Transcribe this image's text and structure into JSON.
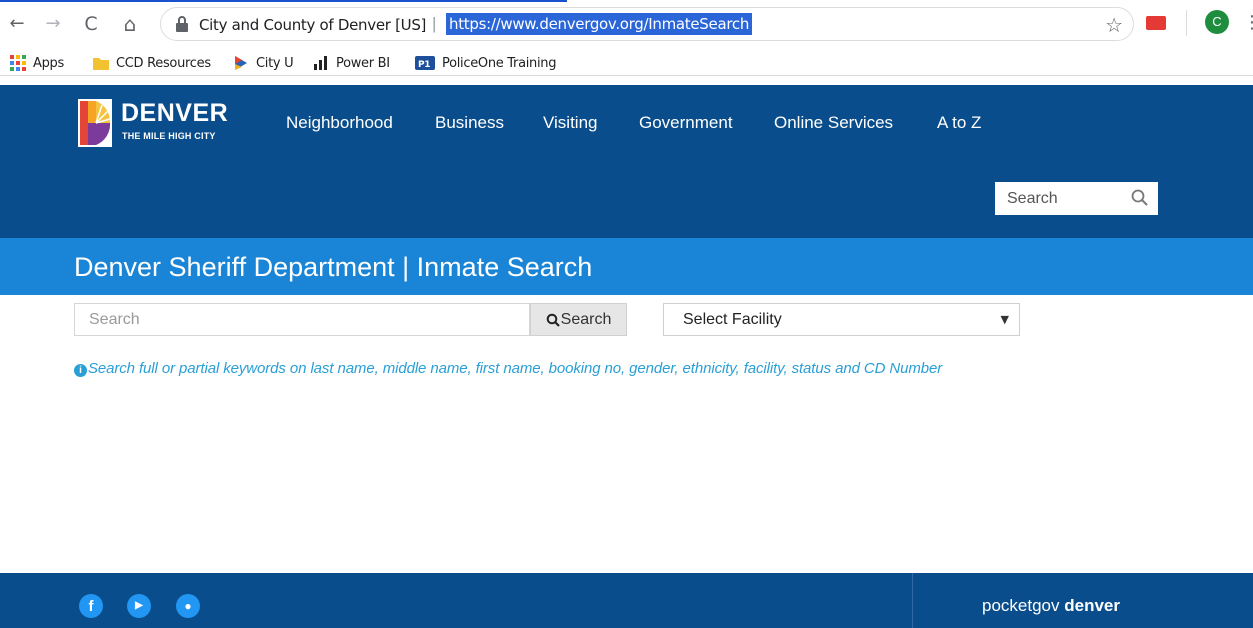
{
  "browser": {
    "site_identity": "City and County of Denver [US]",
    "separator": "|",
    "url": "https://www.denvergov.org/InmateSearch",
    "back_icon": "←",
    "forward_icon": "→",
    "reload_icon": "C",
    "home_icon": "⌂",
    "star_icon": "☆",
    "menu_icon": "⋮",
    "avatar_initial": "C",
    "url_highlight_color": "#2b66d9"
  },
  "bookmarks": [
    {
      "label": "Apps",
      "icon": "apps-grid-icon"
    },
    {
      "label": "CCD Resources",
      "icon": "folder-icon"
    },
    {
      "label": "City U",
      "icon": "city-u-icon"
    },
    {
      "label": "Power BI",
      "icon": "power-bi-icon"
    },
    {
      "label": "PoliceOne Training",
      "icon": "policeone-icon"
    }
  ],
  "header": {
    "logo_word": "DENVER",
    "logo_tagline": "THE MILE HIGH CITY",
    "nav": [
      "Neighborhood",
      "Business",
      "Visiting",
      "Government",
      "Online Services",
      "A to Z"
    ],
    "search_placeholder": "Search",
    "background_color": "#0a4d8c"
  },
  "main": {
    "title": "Denver Sheriff Department | Inmate Search",
    "search_placeholder": "Search",
    "search_button": "Search",
    "facility_select": "Select Facility",
    "facility_caret": "▼",
    "hint_icon": "i",
    "hint": "Search full or partial keywords on last name, middle name, first name, booking no, gender, ethnicity, facility, status and CD Number",
    "band_color": "#1a85d6"
  },
  "footer": {
    "social": [
      {
        "label": "f",
        "icon": "facebook-icon"
      },
      {
        "label": "▶",
        "icon": "youtube-icon"
      },
      {
        "label": "●",
        "icon": "flickr-icon"
      }
    ],
    "pocketgov_prefix": "pocketgov",
    "pocketgov_suffix": "denver"
  }
}
